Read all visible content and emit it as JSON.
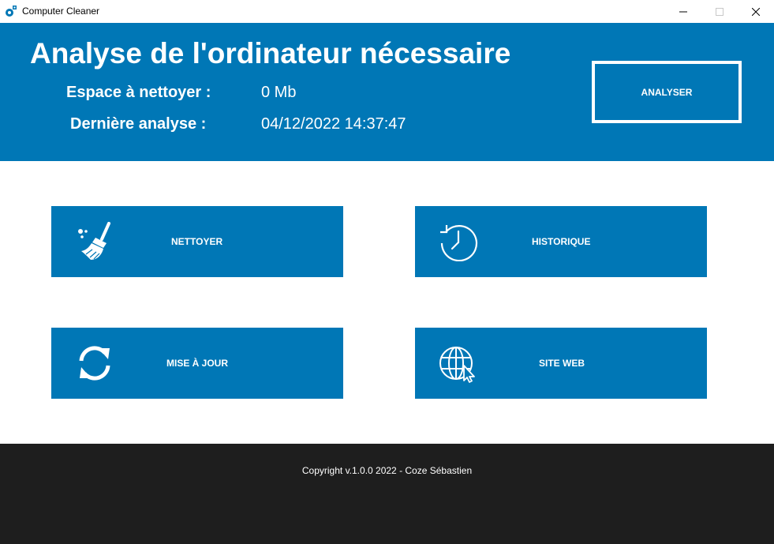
{
  "window": {
    "title": "Computer Cleaner"
  },
  "header": {
    "title": "Analyse de l'ordinateur nécessaire",
    "space_label": "Espace à nettoyer :",
    "space_value": "0 Mb",
    "last_label": "Dernière analyse :",
    "last_value": "04/12/2022 14:37:47",
    "analyse_button": "ANALYSER"
  },
  "tiles": {
    "clean": {
      "label": "NETTOYER",
      "icon": "broom-icon"
    },
    "history": {
      "label": "HISTORIQUE",
      "icon": "history-clock-icon"
    },
    "update": {
      "label": "MISE À JOUR",
      "icon": "refresh-icon"
    },
    "website": {
      "label": "SITE WEB",
      "icon": "globe-cursor-icon"
    }
  },
  "footer": {
    "copyright": "Copyright v.1.0.0 2022 - Coze Sébastien"
  },
  "colors": {
    "primary": "#0077b6",
    "footer": "#1e1e1e",
    "text_on_primary": "#ffffff"
  }
}
